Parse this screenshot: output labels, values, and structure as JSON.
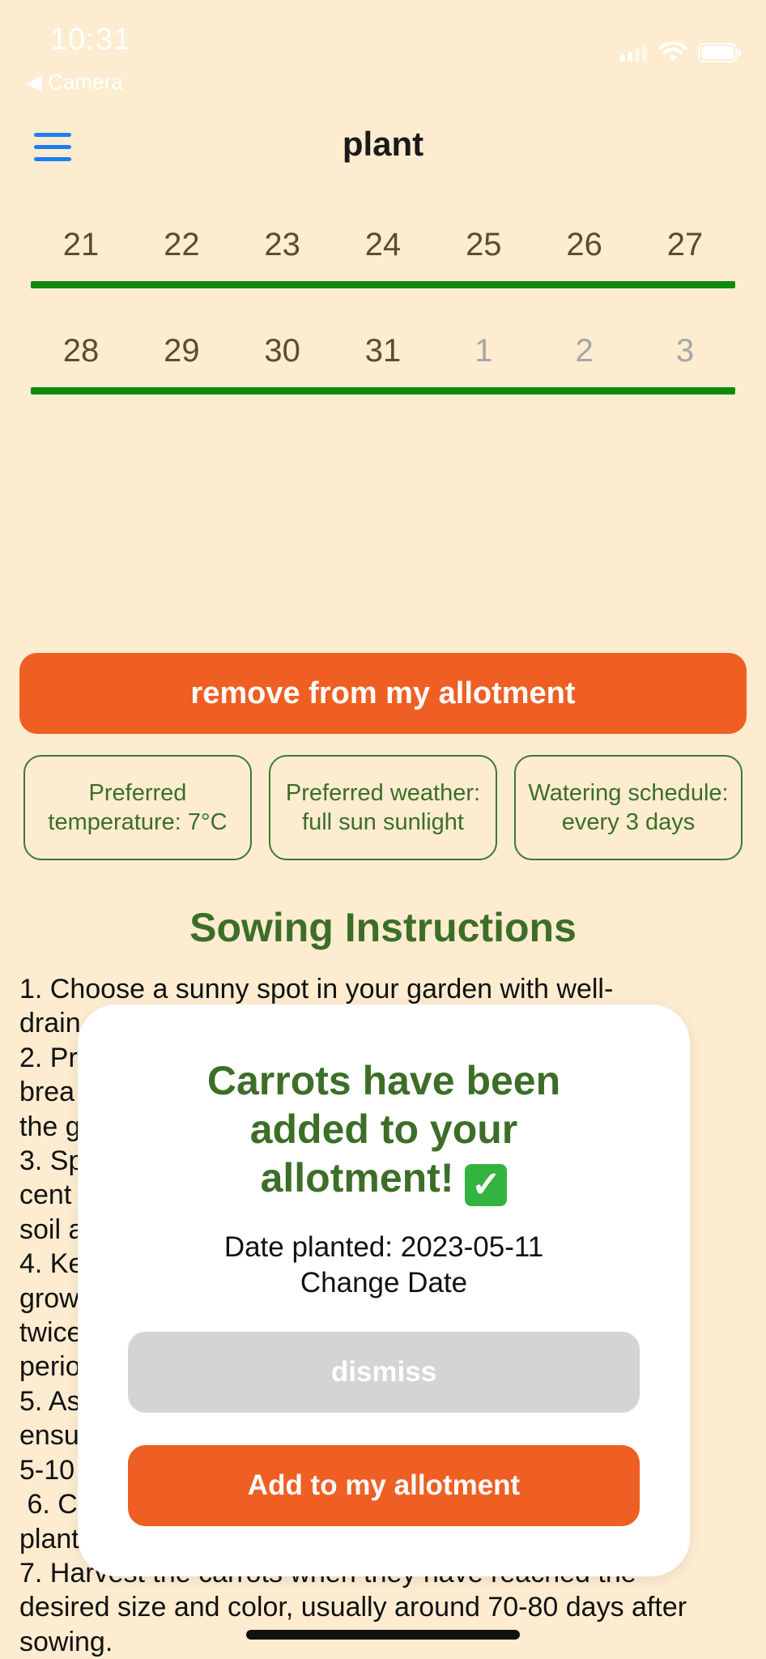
{
  "status_bar": {
    "time": "10:31",
    "back_label": "◀ Camera"
  },
  "header": {
    "title": "plant",
    "menu_icon": "hamburger-menu-icon",
    "accent_color": "#1c7ef0"
  },
  "calendar": {
    "weeks": [
      [
        {
          "day": "21",
          "muted": false
        },
        {
          "day": "22",
          "muted": false
        },
        {
          "day": "23",
          "muted": false
        },
        {
          "day": "24",
          "muted": false
        },
        {
          "day": "25",
          "muted": false
        },
        {
          "day": "26",
          "muted": false
        },
        {
          "day": "27",
          "muted": false
        }
      ],
      [
        {
          "day": "28",
          "muted": false
        },
        {
          "day": "29",
          "muted": false
        },
        {
          "day": "30",
          "muted": false
        },
        {
          "day": "31",
          "muted": false
        },
        {
          "day": "1",
          "muted": true
        },
        {
          "day": "2",
          "muted": true
        },
        {
          "day": "3",
          "muted": true
        }
      ]
    ],
    "bar_color": "#0f8a0f"
  },
  "actions": {
    "remove_label": "remove from my allotment"
  },
  "info_chips": [
    "Preferred temperature: 7°C",
    "Preferred weather: full sun sunlight",
    "Watering schedule: every 3 days"
  ],
  "sowing": {
    "title": "Sowing Instructions",
    "lines": [
      "1. Choose a sunny spot in your garden with well-",
      "drain",
      "2. Pr",
      "brea                                                                    into",
      "the g",
      "3. Sp",
      "cent                                                                   r of",
      "soil a",
      "4. Ke",
      "grow",
      "twice",
      "perio",
      "5. As",
      "ensu                                                                  bout",
      "5-10",
      " 6. C",
      "plant",
      "7. Harvest the carrots when they have reached the",
      "desired size and color, usually around 70-80 days after",
      "sowing."
    ]
  },
  "modal": {
    "title_lines": [
      "Carrots have been",
      "added to your",
      "allotment!"
    ],
    "check_icon": "check-mark-icon",
    "date_planted": "Date planted: 2023-05-11",
    "change_date": "Change Date",
    "dismiss_label": "dismiss",
    "add_label": "Add to my allotment"
  },
  "colors": {
    "background": "#fdecd0",
    "brand_orange": "#ef5f23",
    "brand_green": "#3c6e27"
  }
}
